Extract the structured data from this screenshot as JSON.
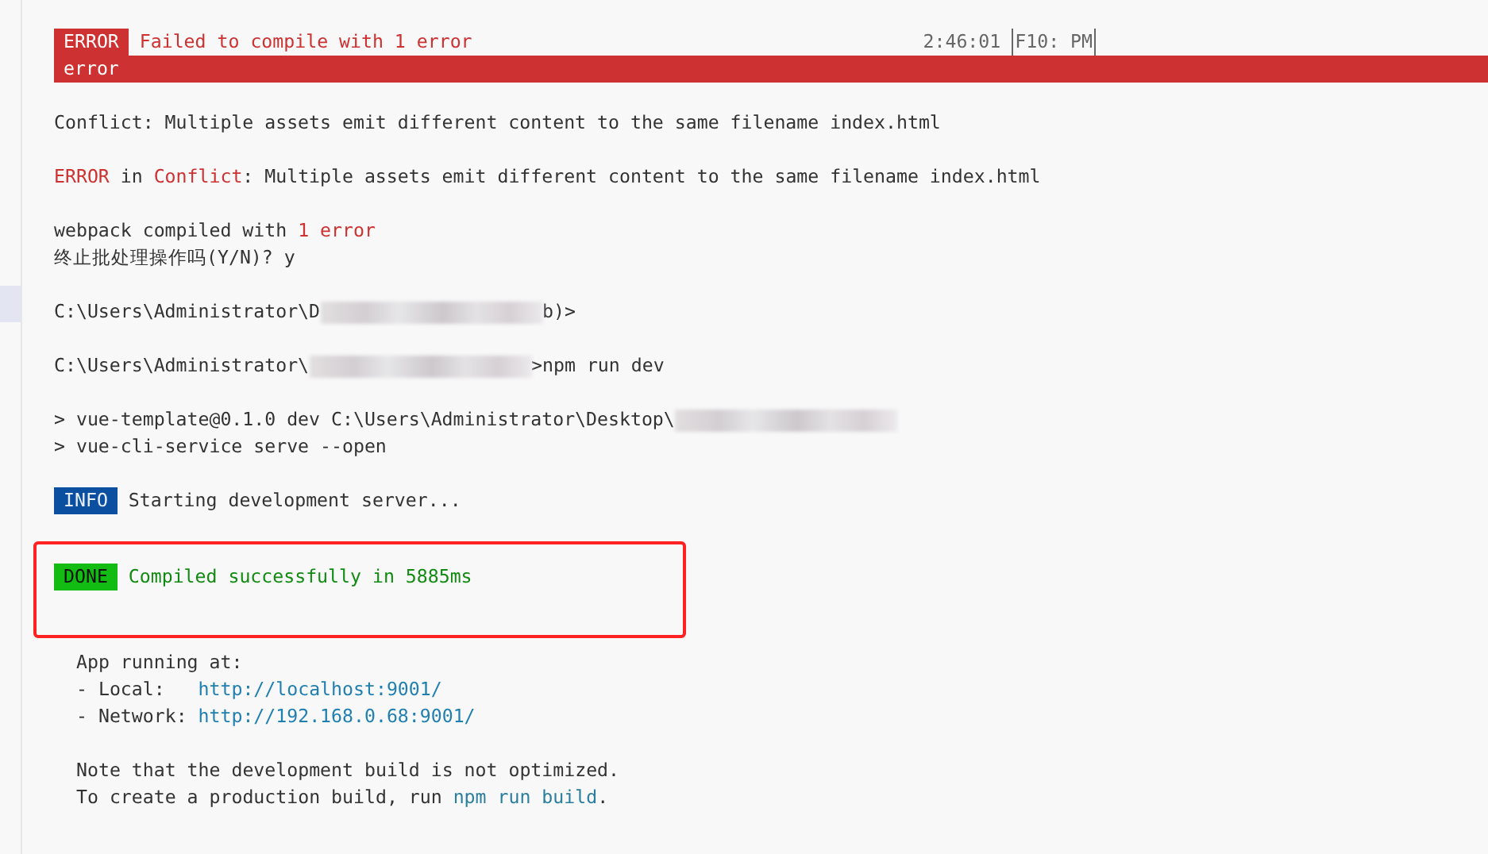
{
  "terminal": {
    "lines": [
      {
        "kind": "header",
        "badge": "ERROR",
        "message": "Failed to compile with 1 error",
        "time": "2:46:01",
        "time_suffix": "F10: PM"
      },
      {
        "kind": "banner",
        "text": "error"
      },
      {
        "kind": "blank"
      },
      {
        "kind": "text",
        "segments": [
          {
            "kind": "plain",
            "text": "Conflict: Multiple assets emit different content to the same filename index.html"
          }
        ]
      },
      {
        "kind": "blank"
      },
      {
        "kind": "text",
        "segments": [
          {
            "kind": "error",
            "text": "ERROR"
          },
          {
            "kind": "plain",
            "text": " in "
          },
          {
            "kind": "error",
            "text": "Conflict"
          },
          {
            "kind": "plain",
            "text": ": Multiple assets emit different content to the same filename index.html"
          }
        ]
      },
      {
        "kind": "blank"
      },
      {
        "kind": "text",
        "segments": [
          {
            "kind": "plain",
            "text": "webpack compiled with "
          },
          {
            "kind": "error",
            "text": "1 error"
          }
        ]
      },
      {
        "kind": "text",
        "segments": [
          {
            "kind": "plain",
            "text": "终止批处理操作吗(Y/N)? y"
          }
        ]
      },
      {
        "kind": "blank"
      },
      {
        "kind": "text",
        "segments": [
          {
            "kind": "plain",
            "text": "C:\\Users\\Administrator\\D"
          },
          {
            "kind": "redacted"
          },
          {
            "kind": "plain",
            "text": "b)>"
          }
        ]
      },
      {
        "kind": "blank"
      },
      {
        "kind": "text",
        "segments": [
          {
            "kind": "plain",
            "text": "C:\\Users\\Administrator\\"
          },
          {
            "kind": "redacted"
          },
          {
            "kind": "plain",
            "text": ">npm run dev"
          }
        ]
      },
      {
        "kind": "blank"
      },
      {
        "kind": "text",
        "segments": [
          {
            "kind": "plain",
            "text": "> vue-template@0.1.0 dev C:\\Users\\Administrator\\Desktop\\"
          },
          {
            "kind": "redacted"
          }
        ]
      },
      {
        "kind": "text",
        "segments": [
          {
            "kind": "plain",
            "text": "> vue-cli-service serve --open"
          }
        ]
      },
      {
        "kind": "blank"
      },
      {
        "kind": "text",
        "segments": [
          {
            "kind": "info_badge",
            "text": "INFO"
          },
          {
            "kind": "plain",
            "text": " Starting development server..."
          }
        ]
      },
      {
        "kind": "blank"
      },
      {
        "kind": "marked",
        "lines": [
          {
            "kind": "text",
            "segments": [
              {
                "kind": "success_badge",
                "text": "DONE"
              },
              {
                "kind": "success",
                "text": " Compiled successfully in 5885ms"
              }
            ]
          }
        ]
      },
      {
        "kind": "text",
        "indent": true,
        "segments": [
          {
            "kind": "plain",
            "text": "App running at:"
          }
        ]
      },
      {
        "kind": "text",
        "indent": true,
        "segments": [
          {
            "kind": "plain",
            "text": "- Local:   "
          },
          {
            "kind": "link",
            "text": "http://localhost:9001/"
          }
        ]
      },
      {
        "kind": "text",
        "indent": true,
        "segments": [
          {
            "kind": "plain",
            "text": "- Network: "
          },
          {
            "kind": "link",
            "text": "http://192.168.0.68:9001/"
          }
        ]
      },
      {
        "kind": "blank"
      },
      {
        "kind": "text",
        "indent": true,
        "segments": [
          {
            "kind": "plain",
            "text": "Note that the development build is not optimized."
          }
        ]
      },
      {
        "kind": "text",
        "indent": true,
        "segments": [
          {
            "kind": "plain",
            "text": "To create a production build, run "
          },
          {
            "kind": "command",
            "text": "npm run build"
          },
          {
            "kind": "plain",
            "text": "."
          }
        ]
      }
    ]
  }
}
